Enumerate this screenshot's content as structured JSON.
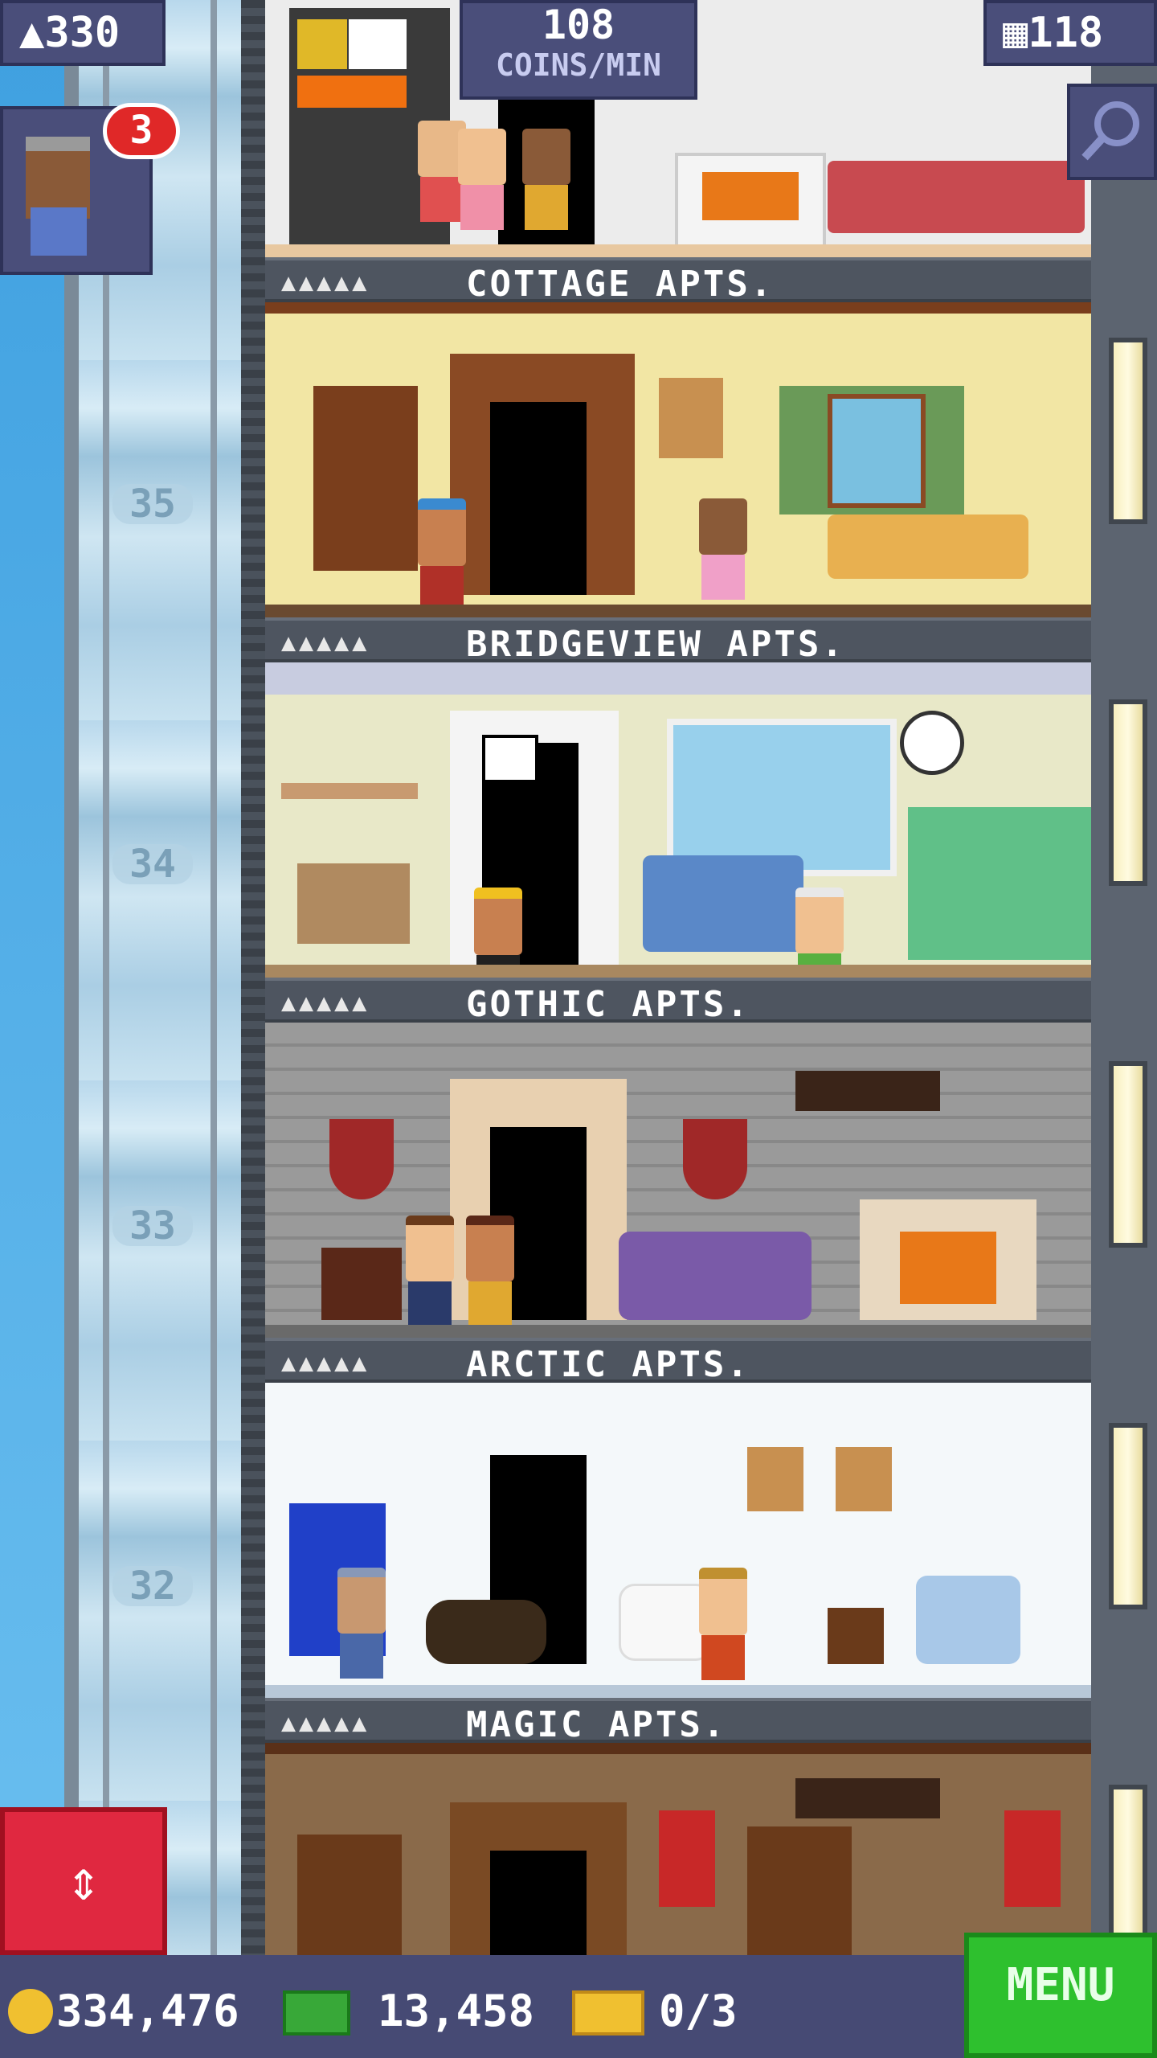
{
  "hud": {
    "population": "330",
    "coins_per_min_value": "108",
    "coins_per_min_label": "COINS/MIN",
    "floor_count": "118",
    "visitor_badge": "3"
  },
  "shaft_numbers": [
    "35",
    "34",
    "33",
    "32"
  ],
  "floors": [
    {
      "name": "COTTAGE APTS.",
      "people": "▲▲▲▲▲"
    },
    {
      "name": "BRIDGEVIEW APTS.",
      "people": "▲▲▲▲▲"
    },
    {
      "name": "GOTHIC APTS.",
      "people": "▲▲▲▲▲"
    },
    {
      "name": "ARCTIC APTS.",
      "people": "▲▲▲▲▲"
    },
    {
      "name": "MAGIC APTS.",
      "people": "▲▲▲▲▲"
    }
  ],
  "bottom": {
    "coins": "334,476",
    "bux": "13,458",
    "tickets": "0/3",
    "menu_label": "MENU"
  },
  "icons": {
    "population": "person-icon",
    "floors": "building-icon",
    "zoom": "magnifier-icon",
    "elevator": "up-down-arrows-icon",
    "coins": "coin-icon",
    "bux": "bux-icon",
    "tickets": "ticket-icon"
  }
}
